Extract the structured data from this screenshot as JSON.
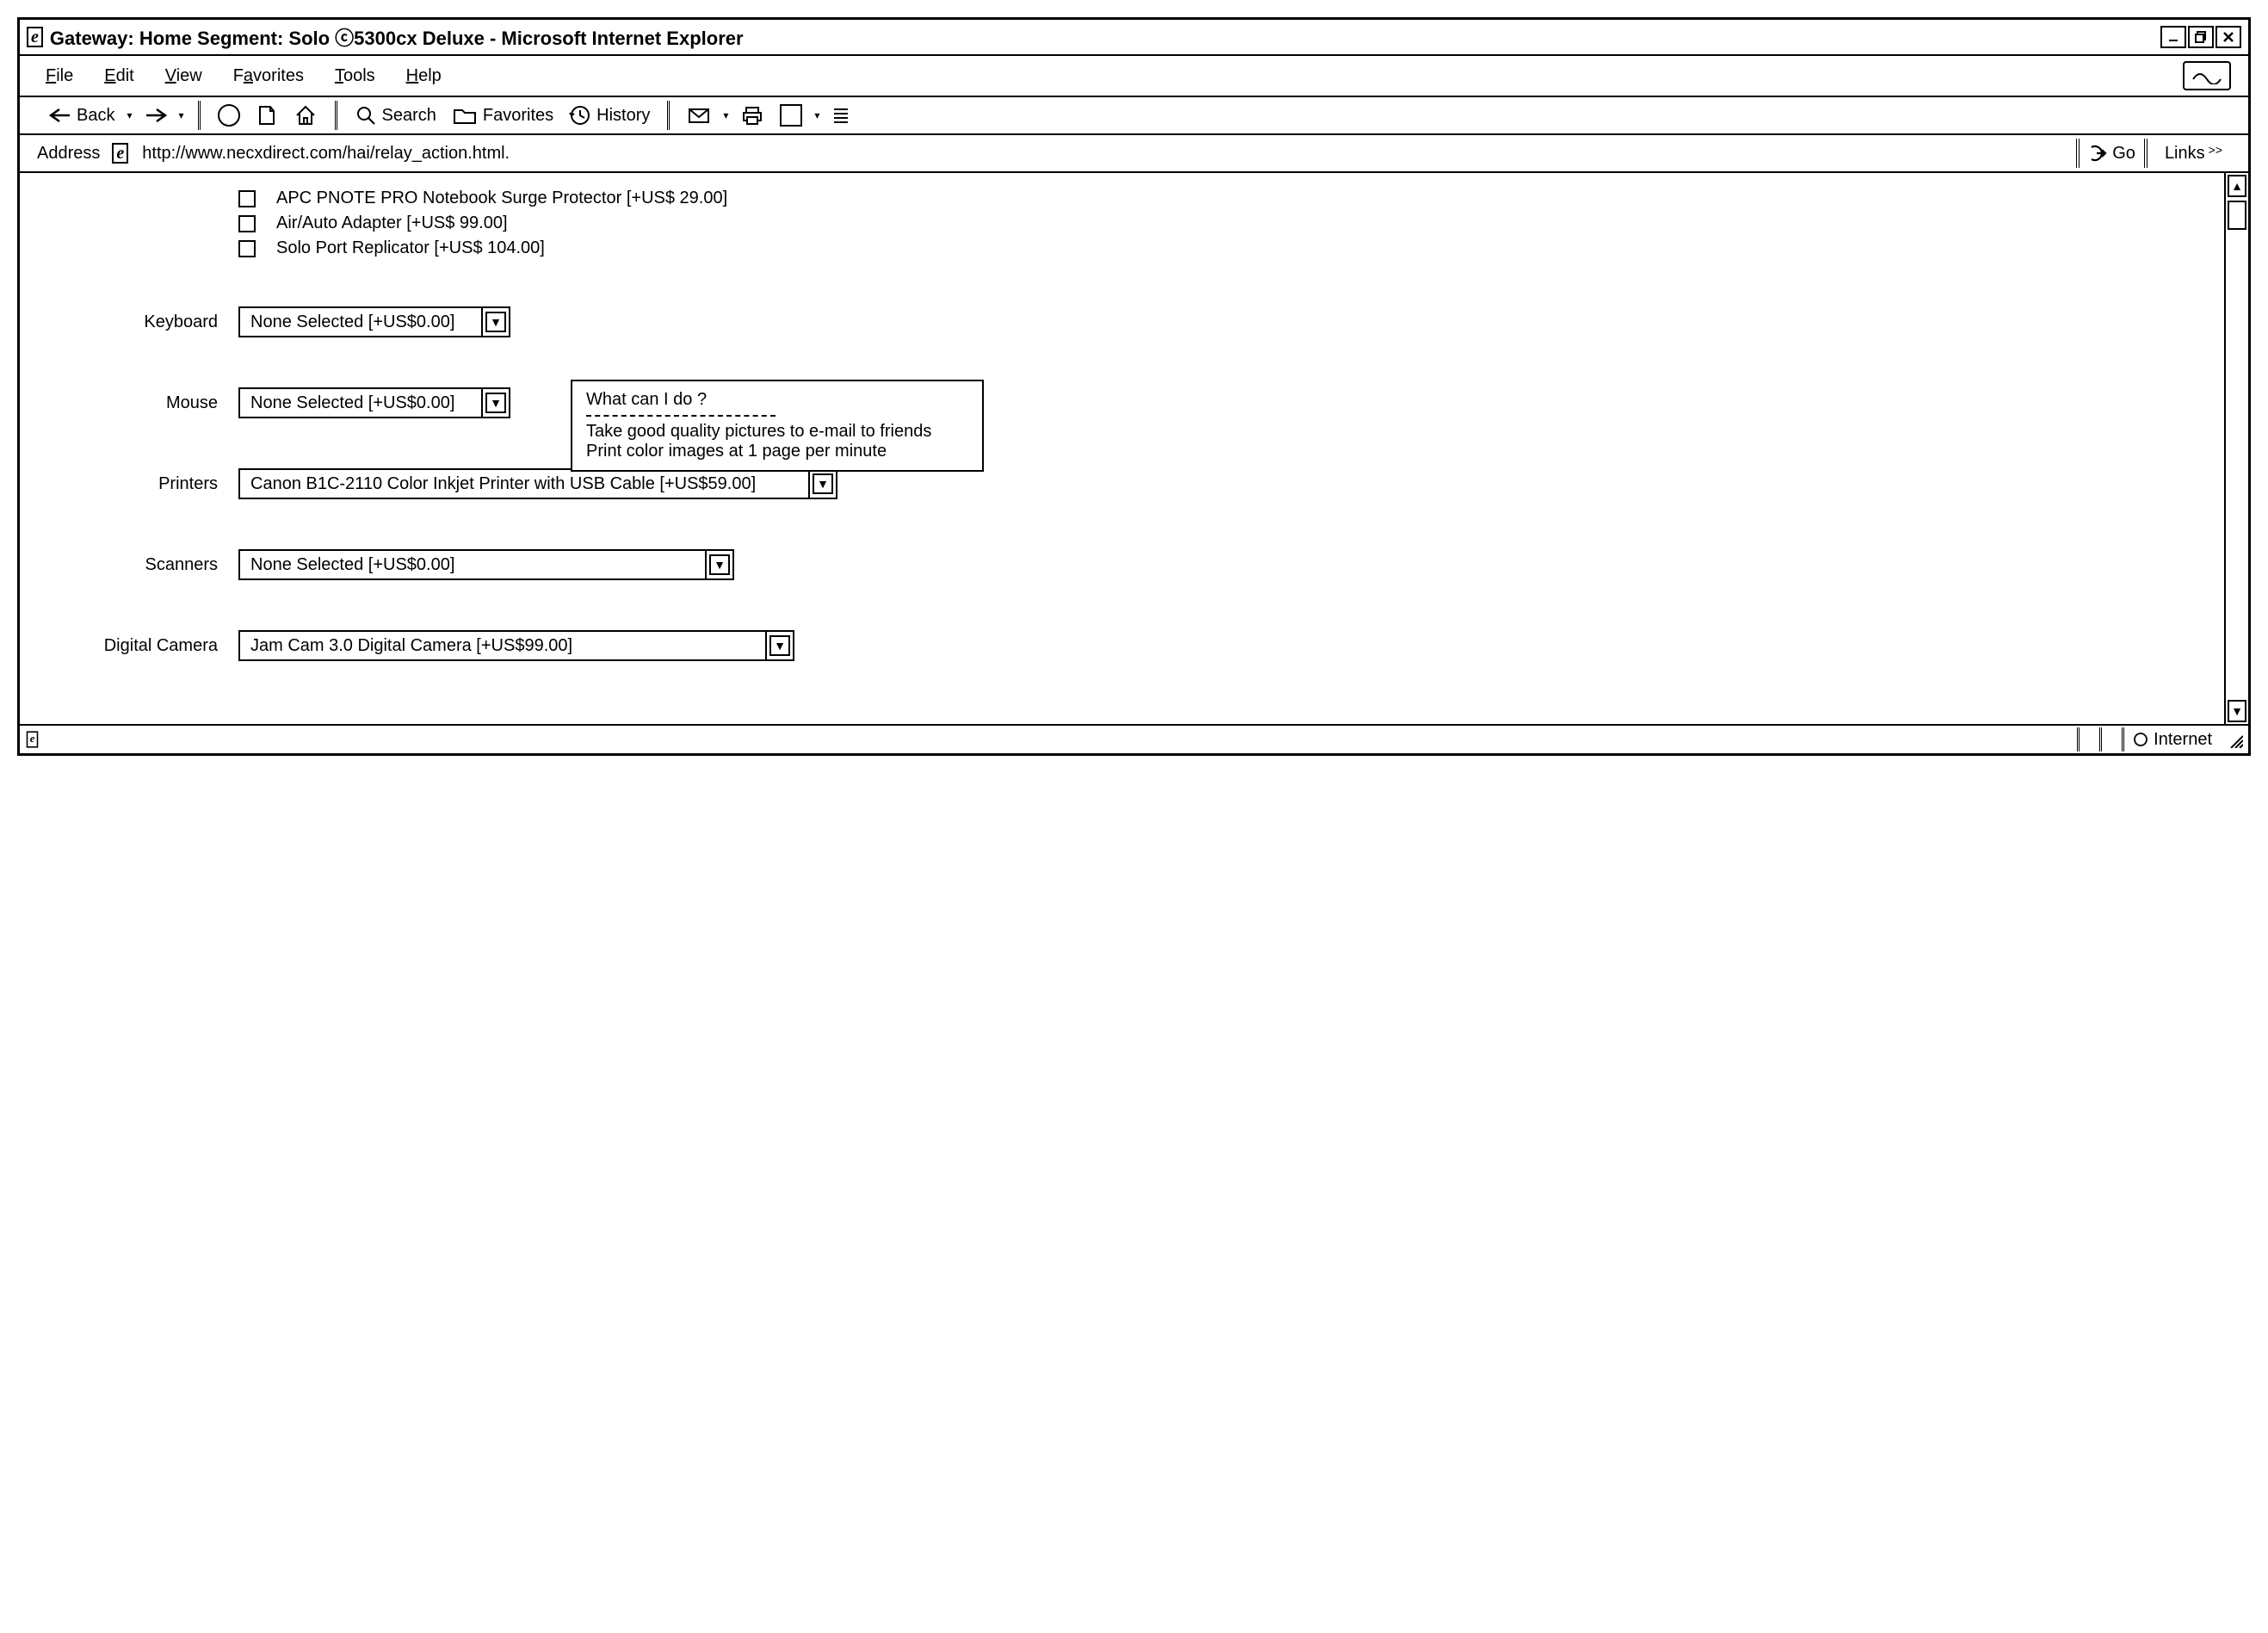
{
  "title_bar": {
    "title": "Gateway: Home Segment: Solo ⓒ5300cx Deluxe - Microsoft Internet Explorer"
  },
  "menu": {
    "file": "File",
    "edit": "Edit",
    "view": "View",
    "favorites": "Favorites",
    "tools": "Tools",
    "help": "Help"
  },
  "toolbar": {
    "back": "Back",
    "search": "Search",
    "favorites": "Favorites",
    "history": "History"
  },
  "address_bar": {
    "label": "Address",
    "url": "http://www.necxdirect.com/hai/relay_action.html.",
    "go": "Go",
    "links": "Links"
  },
  "options": {
    "checkboxes": [
      "APC PNOTE PRO Notebook Surge Protector [+US$ 29.00]",
      "Air/Auto Adapter [+US$ 99.00]",
      "Solo Port Replicator [+US$ 104.00]"
    ],
    "keyboard": {
      "label": "Keyboard",
      "selected": "None Selected [+US$0.00]"
    },
    "mouse": {
      "label": "Mouse",
      "selected": "None Selected [+US$0.00]"
    },
    "printers": {
      "label": "Printers",
      "selected": "Canon B1C-2110 Color Inkjet Printer with USB Cable [+US$59.00]"
    },
    "scanners": {
      "label": "Scanners",
      "selected": "None Selected [+US$0.00]"
    },
    "camera": {
      "label": "Digital Camera",
      "selected": "Jam Cam 3.0 Digital Camera [+US$99.00]"
    }
  },
  "tooltip": {
    "heading": "What can I do ?",
    "line1": "Take good quality pictures to e-mail to friends",
    "line2": "Print color images at 1 page per minute"
  },
  "status": {
    "zone": "Internet"
  }
}
